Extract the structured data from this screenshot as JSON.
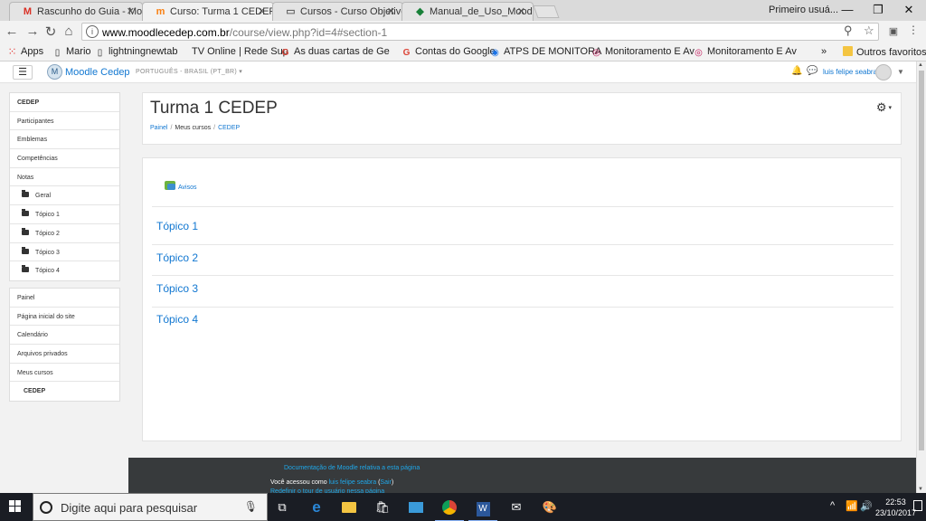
{
  "browser": {
    "tabs": [
      {
        "title": "Rascunho do Guia - Moo",
        "icon": "gmail-icon",
        "color": "#d93025"
      },
      {
        "title": "Curso: Turma 1 CEDEP",
        "icon": "moodle-icon",
        "color": "#f98012"
      },
      {
        "title": "Cursos - Curso Objetivo",
        "icon": "page-icon",
        "color": "#666666"
      },
      {
        "title": "Manual_de_Uso_Moodle",
        "icon": "drive-icon",
        "color": "#188038"
      }
    ],
    "tab_close": "✕",
    "profile_label": "Primeiro usuá...",
    "window_controls": {
      "minimize": "—",
      "restore": "❐",
      "close": "✕"
    },
    "url_host": "www.moodlecedep.com.br",
    "url_path": "/course/view.php?id=4#section-1",
    "bookmarks": [
      {
        "label": "Apps",
        "icon": "apps-icon"
      },
      {
        "label": "Mario",
        "icon": "page-icon"
      },
      {
        "label": "lightningnewtab",
        "icon": "page-icon"
      },
      {
        "label": "TV Online | Rede Sup",
        "icon": "none"
      },
      {
        "label": "As duas cartas de Ge",
        "icon": "google-icon"
      },
      {
        "label": "Contas do Google",
        "icon": "google-icon"
      },
      {
        "label": "ATPS DE MONITORA",
        "icon": "shield-icon"
      },
      {
        "label": "Monitoramento E Av",
        "icon": "circle-icon"
      },
      {
        "label": "Monitoramento E Av",
        "icon": "circle-icon"
      }
    ],
    "bookmarks_overflow": "»",
    "other_bookmarks": "Outros favoritos"
  },
  "moodle": {
    "site_name": "Moodle Cedep",
    "language": "PORTUGUÊS - BRASIL (PT_BR)",
    "user_name": "luis felipe seabra",
    "nav_groups": [
      [
        {
          "label": "CEDEP",
          "style": "bold"
        },
        {
          "label": "Participantes",
          "style": ""
        },
        {
          "label": "Emblemas",
          "style": ""
        },
        {
          "label": "Competências",
          "style": ""
        },
        {
          "label": "Notas",
          "style": ""
        },
        {
          "label": "Geral",
          "style": "folder"
        },
        {
          "label": "Tópico 1",
          "style": "folder"
        },
        {
          "label": "Tópico 2",
          "style": "folder"
        },
        {
          "label": "Tópico 3",
          "style": "folder"
        },
        {
          "label": "Tópico 4",
          "style": "folder"
        }
      ],
      [
        {
          "label": "Painel",
          "style": ""
        },
        {
          "label": "Página inicial do site",
          "style": ""
        },
        {
          "label": "Calendário",
          "style": ""
        },
        {
          "label": "Arquivos privados",
          "style": ""
        },
        {
          "label": "Meus cursos",
          "style": ""
        },
        {
          "label": "CEDEP",
          "style": "sub2"
        }
      ]
    ],
    "page_title": "Turma 1 CEDEP",
    "breadcrumbs": [
      "Painel",
      "Meus cursos",
      "CEDEP"
    ],
    "forum_link": "Avisos",
    "topics": [
      "Tópico 1",
      "Tópico 2",
      "Tópico 3",
      "Tópico 4"
    ],
    "footer": {
      "docs_link": "Documentação de Moodle relativa a esta página",
      "access_prefix": "Você acessou como",
      "access_user": "luis felipe seabra",
      "logout": "Sair",
      "reset_tour": "Redefinir o tour de usuário nessa página"
    }
  },
  "taskbar": {
    "search_placeholder": "Digite aqui para pesquisar",
    "time": "22:53",
    "date": "23/10/2017"
  }
}
